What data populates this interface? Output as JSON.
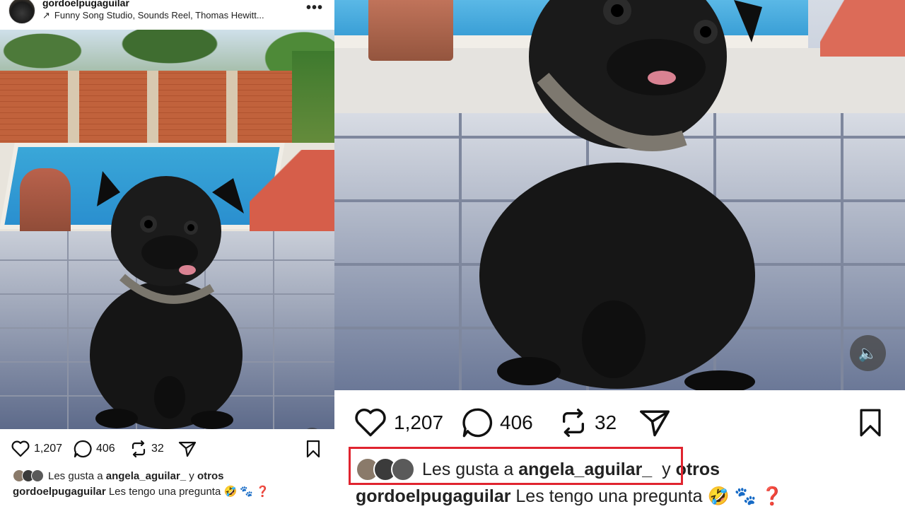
{
  "post": {
    "username": "gordoelpugaguilar",
    "audio": "Funny Song Studio, Sounds Reel, Thomas Hewitt...",
    "more_icon": "more-dots-icon",
    "more_label": "•••"
  },
  "actions": {
    "likes": "1,207",
    "comments": "406",
    "reposts": "32"
  },
  "liked_by": {
    "prefix": "Les gusta a",
    "user": "angela_aguilar_",
    "joiner": "y",
    "suffix": "otros"
  },
  "caption": {
    "username": "gordoelpugaguilar",
    "text": "Les tengo una pregunta",
    "emojis": "🤣 🐾 ❓"
  },
  "colors": {
    "highlight": "#e0242f",
    "text": "#111111"
  }
}
